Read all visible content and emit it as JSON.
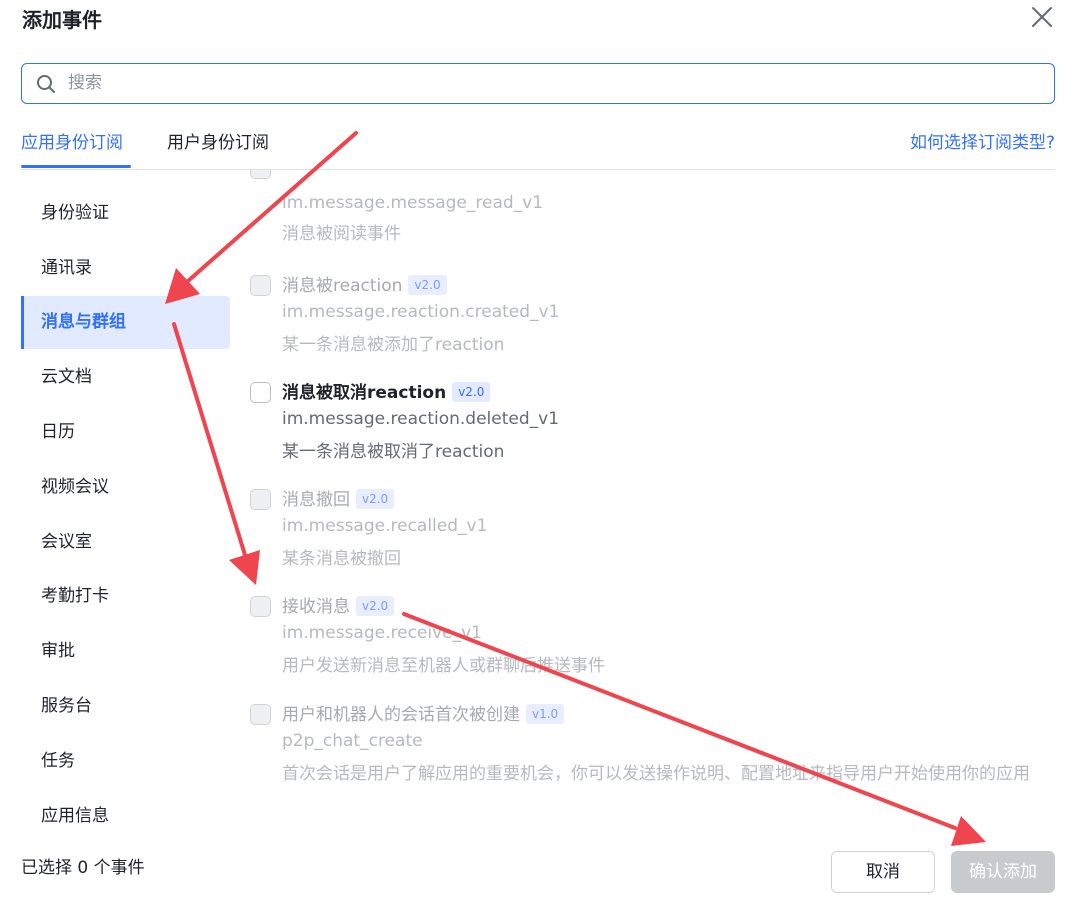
{
  "dialog": {
    "title": "添加事件",
    "close_icon": "close-icon"
  },
  "search": {
    "placeholder": "搜索",
    "value": "",
    "icon": "search-icon"
  },
  "tabs": [
    {
      "label": "应用身份订阅",
      "active": true
    },
    {
      "label": "用户身份订阅",
      "active": false
    }
  ],
  "help_link": "如何选择订阅类型?",
  "sidebar": {
    "items": [
      {
        "label": "身份验证",
        "active": false
      },
      {
        "label": "通讯录",
        "active": false
      },
      {
        "label": "消息与群组",
        "active": true
      },
      {
        "label": "云文档",
        "active": false
      },
      {
        "label": "日历",
        "active": false
      },
      {
        "label": "视频会议",
        "active": false
      },
      {
        "label": "会议室",
        "active": false
      },
      {
        "label": "考勤打卡",
        "active": false
      },
      {
        "label": "审批",
        "active": false
      },
      {
        "label": "服务台",
        "active": false
      },
      {
        "label": "任务",
        "active": false
      },
      {
        "label": "应用信息",
        "active": false
      }
    ]
  },
  "events": [
    {
      "title": "",
      "version": "",
      "key": "im.message.message_read_v1",
      "desc": "消息被阅读事件",
      "enabled": false,
      "checked": false
    },
    {
      "title": "消息被reaction",
      "version": "v2.0",
      "key": "im.message.reaction.created_v1",
      "desc": "某一条消息被添加了reaction",
      "enabled": false,
      "checked": false
    },
    {
      "title": "消息被取消reaction",
      "version": "v2.0",
      "key": "im.message.reaction.deleted_v1",
      "desc": "某一条消息被取消了reaction",
      "enabled": true,
      "checked": false
    },
    {
      "title": "消息撤回",
      "version": "v2.0",
      "key": "im.message.recalled_v1",
      "desc": "某条消息被撤回",
      "enabled": false,
      "checked": false
    },
    {
      "title": "接收消息",
      "version": "v2.0",
      "key": "im.message.receive_v1",
      "desc": "用户发送新消息至机器人或群聊后推送事件",
      "enabled": false,
      "checked": false
    },
    {
      "title": "用户和机器人的会话首次被创建",
      "version": "v1.0",
      "key": "p2p_chat_create",
      "desc": "首次会话是用户了解应用的重要机会，你可以发送操作说明、配置地址来指导用户开始使用你的应用",
      "enabled": false,
      "checked": false
    }
  ],
  "footer": {
    "selected_count": "已选择 0 个事件",
    "cancel_label": "取消",
    "confirm_label": "确认添加"
  },
  "colors": {
    "accent": "#3370ff",
    "annotation_arrow": "#f0454e"
  }
}
